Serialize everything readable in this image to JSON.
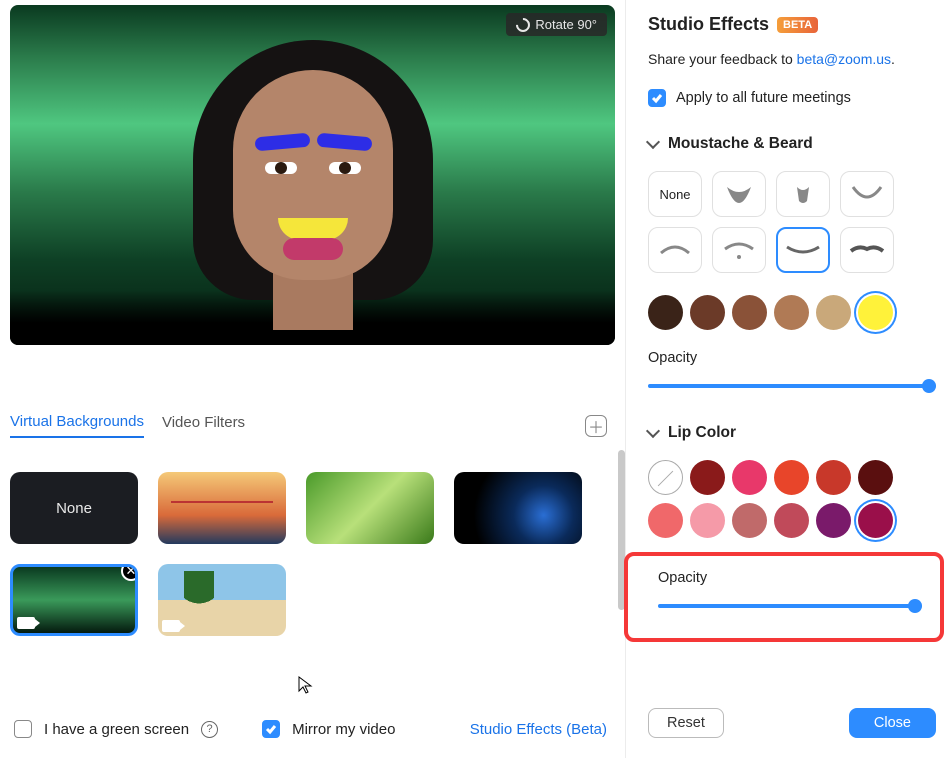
{
  "rotate_label": "Rotate 90°",
  "tabs": {
    "vb": "Virtual Backgrounds",
    "vf": "Video Filters"
  },
  "backgrounds": {
    "none": "None"
  },
  "bottom": {
    "green_screen": "I have a green screen",
    "mirror": "Mirror my video",
    "studio_link": "Studio Effects (Beta)"
  },
  "panel": {
    "title": "Studio Effects",
    "beta": "BETA",
    "feedback_pre": "Share your feedback to ",
    "feedback_mail": "beta@zoom.us",
    "apply_all": "Apply to all future meetings",
    "moustache_hdr": "Moustache & Beard",
    "none_label": "None",
    "opacity": "Opacity",
    "lip_hdr": "Lip Color",
    "reset": "Reset",
    "close": "Close"
  },
  "moustache_colors": [
    "#3a2318",
    "#6b3a28",
    "#8a5238",
    "#b07a55",
    "#c9a87a",
    "#fff23a"
  ],
  "lip_colors_row1": [
    "none",
    "#8a1a1a",
    "#e8386a",
    "#e8452a",
    "#c8382a",
    "#5a0f0f"
  ],
  "lip_colors_row2": [
    "#f0686a",
    "#f59aa8",
    "#c06a6a",
    "#c04a5a",
    "#7a1a6a",
    "#9a0f4a"
  ]
}
